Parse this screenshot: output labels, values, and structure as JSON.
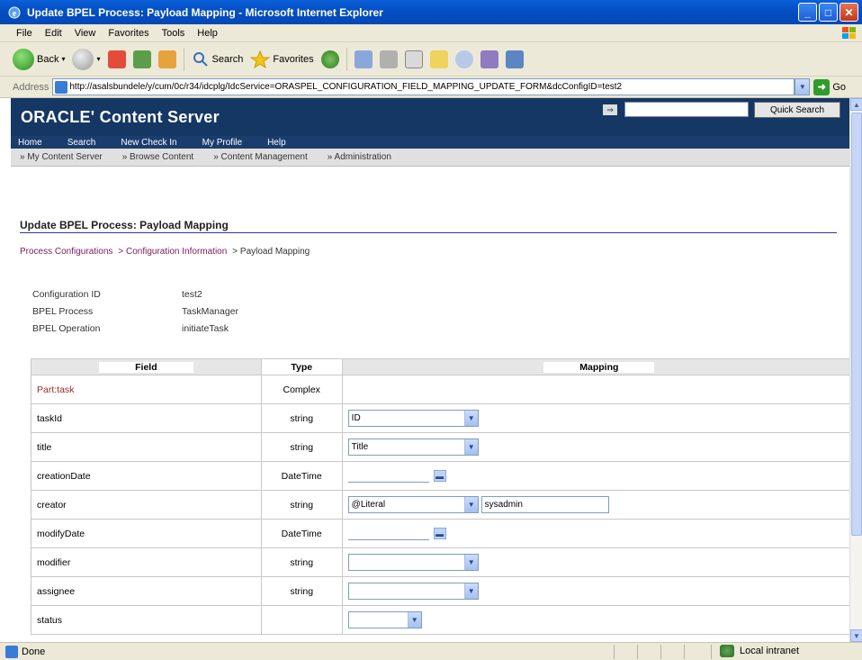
{
  "window": {
    "title": "Update BPEL Process: Payload Mapping - Microsoft Internet Explorer",
    "buttons": [
      "_",
      "□",
      "✕"
    ]
  },
  "menu": {
    "items": [
      "File",
      "Edit",
      "View",
      "Favorites",
      "Tools",
      "Help"
    ]
  },
  "toolbar": {
    "back_label": "Back",
    "search_label": "Search",
    "favorites_label": "Favorites"
  },
  "address": {
    "label": "Address",
    "url": "http://asalsbundele/y/cum/0c/r34/idcplg/IdcService=ORASPEL_CONFIGURATION_FIELD_MAPPING_UPDATE_FORM&dcConfigID=test2",
    "go_label": "Go"
  },
  "header": {
    "brand": "ORACLE' Content Server",
    "quick_search_label": "Quick Search"
  },
  "nav": {
    "primary": [
      "Home",
      "Search",
      "New Check In",
      "My Profile",
      "Help"
    ],
    "secondary": [
      "» My Content Server",
      "» Browse Content",
      "» Content Management",
      "» Administration"
    ]
  },
  "page": {
    "title": "Update BPEL Process: Payload Mapping",
    "breadcrumb": {
      "item1": "Process Configurations",
      "item2": "> Configuration Information",
      "item3": "> Payload Mapping"
    },
    "info": [
      {
        "label": "Configuration ID",
        "value": "test2"
      },
      {
        "label": "BPEL Process",
        "value": "TaskManager"
      },
      {
        "label": "BPEL Operation",
        "value": "initiateTask"
      }
    ]
  },
  "grid": {
    "headers": {
      "field": "Field",
      "type": "Type",
      "mapping": "Mapping"
    },
    "rows": [
      {
        "field": "Part:task",
        "type": "Complex",
        "mapping": ""
      },
      {
        "field": "taskId",
        "type": "string",
        "mapping": "ID"
      },
      {
        "field": "title",
        "type": "string",
        "mapping": "Title"
      },
      {
        "field": "creationDate",
        "type": "DateTime",
        "mapping": ""
      },
      {
        "field": "creator",
        "type": "string",
        "mapping": "@Literal",
        "extra": "sysadmin"
      },
      {
        "field": "modifyDate",
        "type": "DateTime",
        "mapping": ""
      },
      {
        "field": "modifier",
        "type": "string",
        "mapping": ""
      },
      {
        "field": "assignee",
        "type": "string",
        "mapping": ""
      },
      {
        "field": "status",
        "type": "",
        "mapping": ""
      }
    ]
  },
  "status": {
    "left": "Done",
    "zone": "Local intranet"
  }
}
